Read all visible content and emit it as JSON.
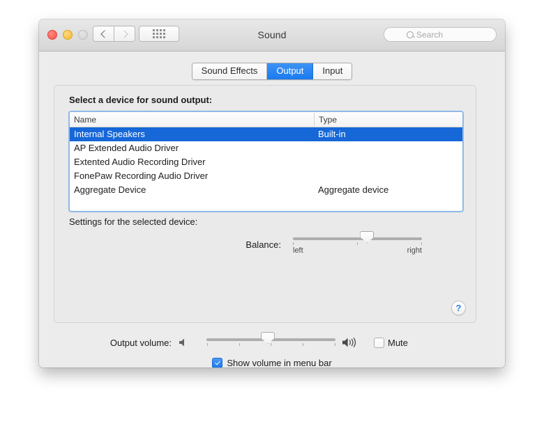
{
  "window": {
    "title": "Sound",
    "traffic_lights": [
      "close",
      "minimize",
      "zoom"
    ],
    "nav": {
      "back": "back-arrow",
      "forward": "forward-arrow"
    },
    "grid_button": "show-all-icon",
    "search": {
      "placeholder": "Search",
      "value": "",
      "icon": "search-icon"
    }
  },
  "tabs": [
    {
      "label": "Sound Effects",
      "active": false
    },
    {
      "label": "Output",
      "active": true
    },
    {
      "label": "Input",
      "active": false
    }
  ],
  "device_section": {
    "label": "Select a device for sound output:",
    "columns": [
      "Name",
      "Type"
    ],
    "rows": [
      {
        "name": "Internal Speakers",
        "type": "Built-in",
        "selected": true
      },
      {
        "name": "AP Extended Audio Driver",
        "type": "",
        "selected": false
      },
      {
        "name": "Extented Audio Recording Driver",
        "type": "",
        "selected": false
      },
      {
        "name": "FonePaw Recording Audio Driver",
        "type": "",
        "selected": false
      },
      {
        "name": "Aggregate Device",
        "type": "Aggregate device",
        "selected": false
      }
    ]
  },
  "settings_section": {
    "label": "Settings for the selected device:",
    "balance": {
      "label": "Balance:",
      "left_label": "left",
      "right_label": "right",
      "value_percent": 57
    },
    "help_button": "?"
  },
  "bottom": {
    "volume": {
      "label": "Output volume:",
      "low_icon": "speaker-low-icon",
      "high_icon": "speaker-high-icon",
      "value_percent": 47
    },
    "mute": {
      "label": "Mute",
      "checked": false
    },
    "show_in_menu_bar": {
      "label": "Show volume in menu bar",
      "checked": true
    }
  },
  "colors": {
    "accent": "#1a7aee",
    "selection": "#1667d8",
    "window_bg": "#ececec",
    "help_blue": "#2f7fe0"
  }
}
